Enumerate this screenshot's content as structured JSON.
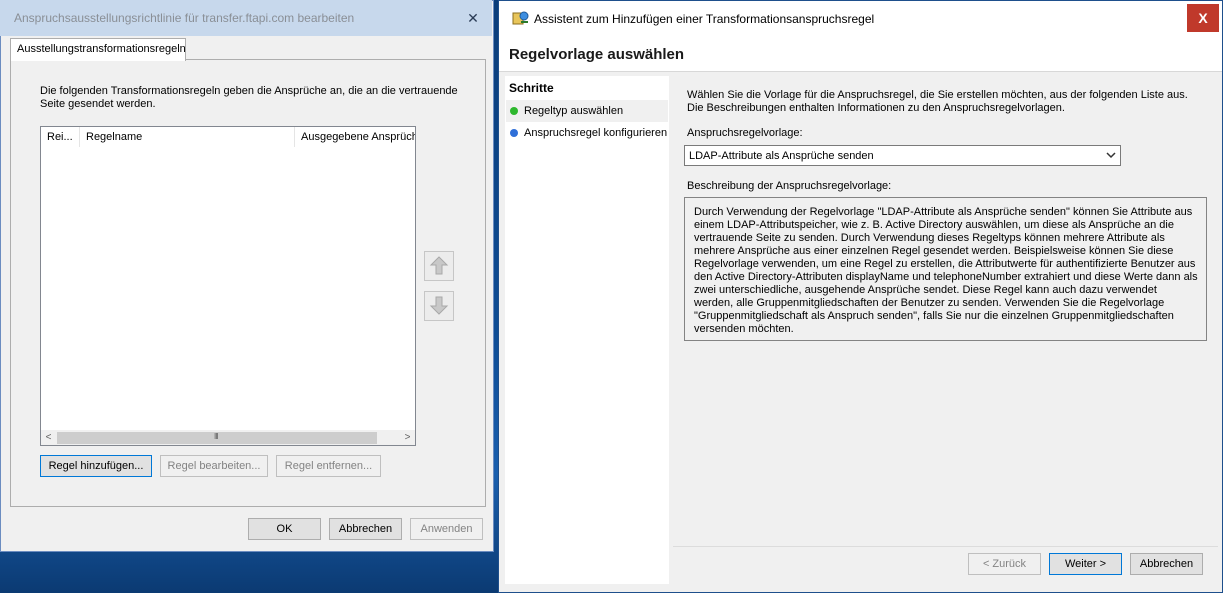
{
  "left_dialog": {
    "title": "Anspruchsausstellungsrichtlinie für transfer.ftapi.com bearbeiten",
    "close": "✕",
    "tab_label": "Ausstellungstransformationsregeln",
    "description": "Die folgenden Transformationsregeln geben die Ansprüche an, die an die vertrauende Seite gesendet werden.",
    "columns": [
      "Rei...",
      "Regelname",
      "Ausgegebene Ansprüch"
    ],
    "scroll_left": "<",
    "scroll_right": ">",
    "scroll_grip": "III",
    "buttons": {
      "add": "Regel hinzufügen...",
      "edit": "Regel bearbeiten...",
      "remove": "Regel entfernen...",
      "ok": "OK",
      "cancel": "Abbrechen",
      "apply": "Anwenden"
    }
  },
  "wizard": {
    "title": "Assistent zum Hinzufügen einer Transformationsanspruchsregel",
    "close": "X",
    "header": "Regelvorlage auswählen",
    "steps_title": "Schritte",
    "steps": [
      {
        "label": "Regeltyp auswählen",
        "status_color": "#2eb82e",
        "current": true
      },
      {
        "label": "Anspruchsregel konfigurieren",
        "status_color": "#2f6fd8",
        "current": false
      }
    ],
    "intro": "Wählen Sie die Vorlage für die Anspruchsregel, die Sie erstellen möchten, aus der folgenden Liste aus. Die Beschreibungen enthalten Informationen zu den Anspruchsregelvorlagen.",
    "template_label": "Anspruchsregelvorlage:",
    "template_value": "LDAP-Attribute als Ansprüche senden",
    "description_label": "Beschreibung der Anspruchsregelvorlage:",
    "description": "Durch Verwendung der Regelvorlage \"LDAP-Attribute als Ansprüche senden\" können Sie Attribute aus einem LDAP-Attributspeicher, wie z. B. Active Directory auswählen, um diese als Ansprüche an die vertrauende Seite zu senden. Durch Verwendung dieses Regeltyps können mehrere Attribute als mehrere Ansprüche aus einer einzelnen Regel gesendet werden. Beispielsweise können Sie diese Regelvorlage verwenden, um eine Regel zu erstellen, die Attributwerte für authentifizierte Benutzer aus den Active Directory-Attributen displayName und telephoneNumber extrahiert und diese Werte dann als zwei unterschiedliche, ausgehende Ansprüche sendet. Diese Regel kann auch dazu verwendet werden, alle Gruppenmitgliedschaften der Benutzer zu senden. Verwenden Sie die Regelvorlage \"Gruppenmitgliedschaft als Anspruch senden\", falls Sie nur die einzelnen Gruppenmitgliedschaften versenden möchten.",
    "buttons": {
      "back": "< Zurück",
      "next": "Weiter >",
      "cancel": "Abbrechen"
    }
  }
}
